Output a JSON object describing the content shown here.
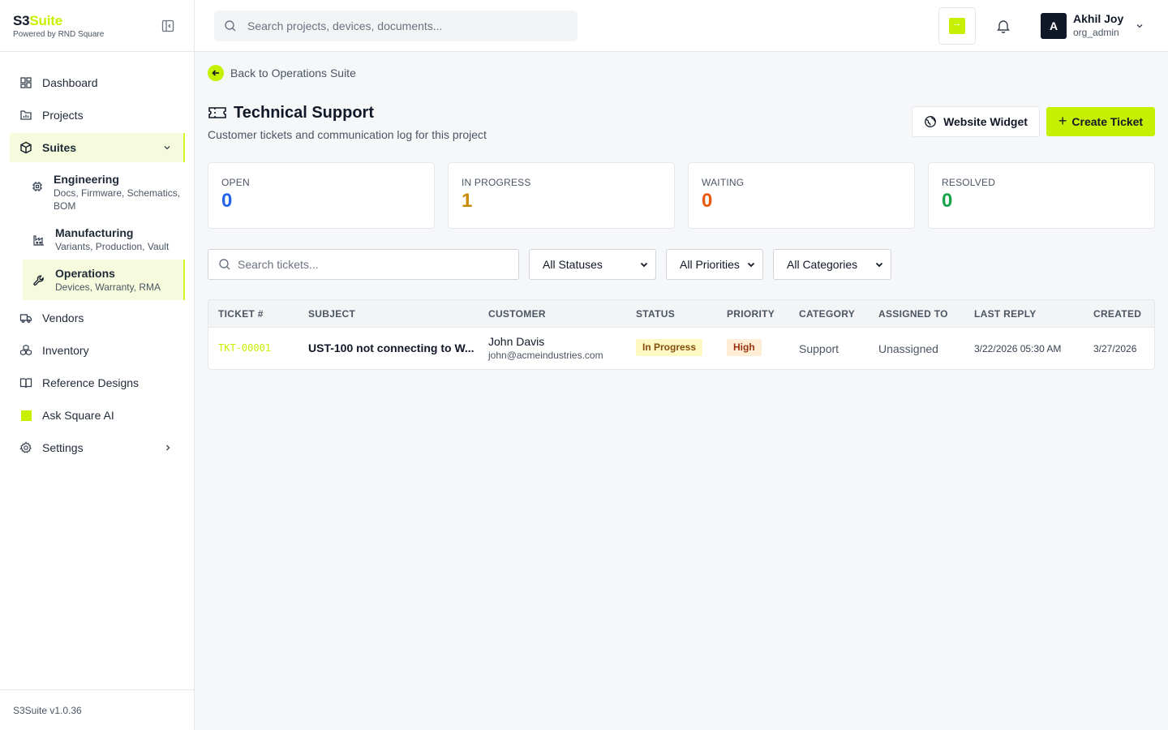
{
  "brand": {
    "name_part1": "S3",
    "name_part2": "Suite",
    "sub": "Powered by RND Square",
    "version": "S3Suite v1.0.36"
  },
  "colors": {
    "accent": "#c6f000",
    "open": "#2563eb",
    "in_progress": "#ca8a04",
    "waiting": "#ea580c",
    "resolved": "#16a34a"
  },
  "sidebar": {
    "items": [
      {
        "label": "Dashboard",
        "icon": "grid-icon"
      },
      {
        "label": "Projects",
        "icon": "folder-chart-icon"
      },
      {
        "label": "Suites",
        "icon": "box-icon"
      },
      {
        "label": "Vendors",
        "icon": "truck-icon"
      },
      {
        "label": "Inventory",
        "icon": "boxes-icon"
      },
      {
        "label": "Reference Designs",
        "icon": "book-icon"
      },
      {
        "label": "Ask Square AI",
        "icon": "lime-square-icon"
      },
      {
        "label": "Settings",
        "icon": "gear-icon"
      }
    ],
    "suites": [
      {
        "title": "Engineering",
        "desc": "Docs, Firmware, Schematics, BOM",
        "icon": "chip-icon"
      },
      {
        "title": "Manufacturing",
        "desc": "Variants, Production, Vault",
        "icon": "factory-icon"
      },
      {
        "title": "Operations",
        "desc": "Devices, Warranty, RMA",
        "icon": "wrench-icon"
      }
    ]
  },
  "topbar": {
    "search_placeholder": "Search projects, devices, documents...",
    "user": {
      "initial": "A",
      "name": "Akhil Joy",
      "role": "org_admin"
    }
  },
  "main": {
    "back_label": "Back to Operations Suite",
    "title": "Technical Support",
    "subtitle": "Customer tickets and communication log for this project",
    "widget_button": "Website Widget",
    "create_button": "Create Ticket",
    "stats": [
      {
        "label": "OPEN",
        "value": "0"
      },
      {
        "label": "IN PROGRESS",
        "value": "1"
      },
      {
        "label": "WAITING",
        "value": "0"
      },
      {
        "label": "RESOLVED",
        "value": "0"
      }
    ],
    "filters": {
      "search_placeholder": "Search tickets...",
      "status": "All Statuses",
      "priority": "All Priorities",
      "category": "All Categories"
    },
    "table": {
      "headers": [
        "TICKET #",
        "SUBJECT",
        "CUSTOMER",
        "STATUS",
        "PRIORITY",
        "CATEGORY",
        "ASSIGNED TO",
        "LAST REPLY",
        "CREATED"
      ],
      "rows": [
        {
          "ticket": "TKT-00001",
          "subject": "UST-100 not connecting to W...",
          "customer_name": "John Davis",
          "customer_email": "john@acmeindustries.com",
          "status": "In Progress",
          "priority": "High",
          "category": "Support",
          "assigned": "Unassigned",
          "last_reply": "3/22/2026 05:30 AM",
          "created": "3/27/2026"
        }
      ]
    }
  }
}
